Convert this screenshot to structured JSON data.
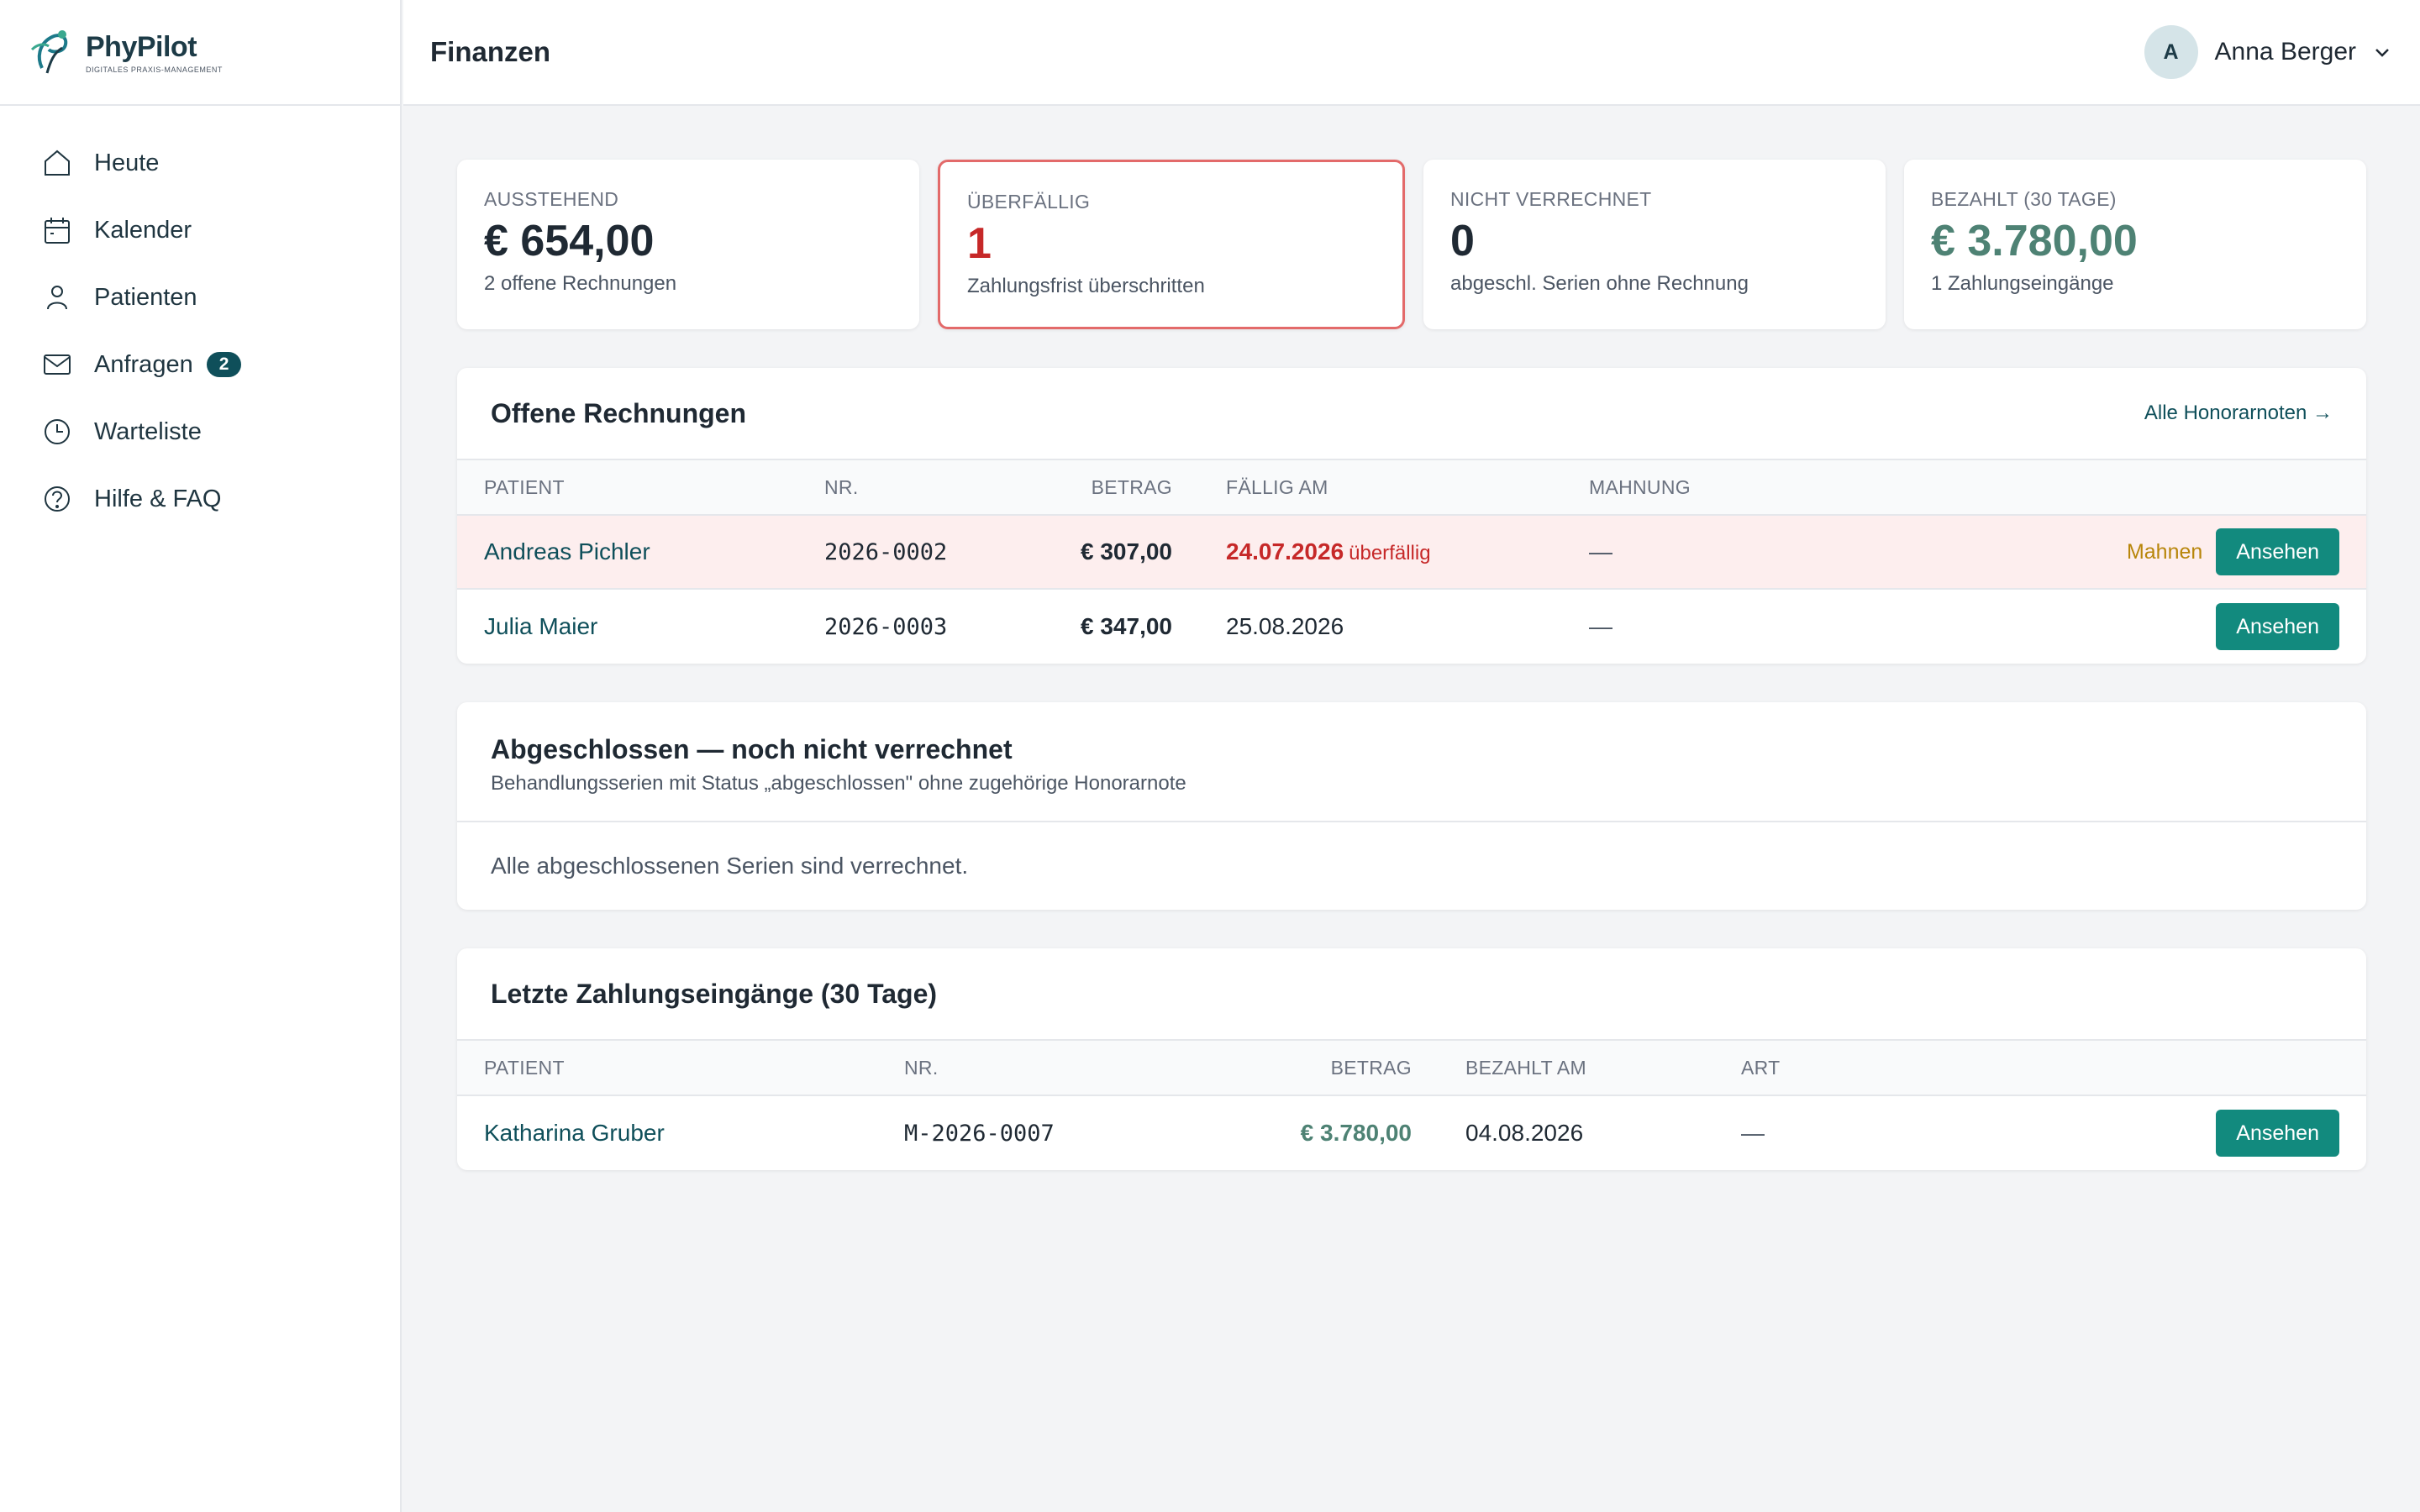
{
  "brand": {
    "name": "PhyPilot",
    "tagline": "DIGITALES PRAXIS-MANAGEMENT"
  },
  "sidebar": {
    "items": [
      {
        "label": "Heute",
        "icon": "home-icon"
      },
      {
        "label": "Kalender",
        "icon": "calendar-icon"
      },
      {
        "label": "Patienten",
        "icon": "person-icon"
      },
      {
        "label": "Anfragen",
        "icon": "mail-icon",
        "badge": "2"
      },
      {
        "label": "Warteliste",
        "icon": "clock-icon"
      },
      {
        "label": "Hilfe & FAQ",
        "icon": "help-icon"
      }
    ]
  },
  "header": {
    "title": "Finanzen",
    "user": {
      "initial": "A",
      "name": "Anna Berger"
    }
  },
  "kpis": [
    {
      "label": "AUSSTEHEND",
      "value": "€ 654,00",
      "sub": "2 offene Rechnungen"
    },
    {
      "label": "ÜBERFÄLLIG",
      "value": "1",
      "sub": "Zahlungsfrist überschritten"
    },
    {
      "label": "NICHT VERRECHNET",
      "value": "0",
      "sub": "abgeschl. Serien ohne Rechnung"
    },
    {
      "label": "BEZAHLT (30 TAGE)",
      "value": "€ 3.780,00",
      "sub": "1 Zahlungseingänge"
    }
  ],
  "open_invoices": {
    "title": "Offene Rechnungen",
    "link": "Alle Honorarnoten →",
    "columns": [
      "PATIENT",
      "NR.",
      "BETRAG",
      "FÄLLIG AM",
      "MAHNUNG"
    ],
    "rows": [
      {
        "patient": "Andreas Pichler",
        "nr": "2026-0002",
        "amount": "€ 307,00",
        "due": "24.07.2026",
        "due_tag": "überfällig",
        "reminder": "—",
        "remind_action": "Mahnen",
        "view_action": "Ansehen"
      },
      {
        "patient": "Julia Maier",
        "nr": "2026-0003",
        "amount": "€ 347,00",
        "due": "25.08.2026",
        "reminder": "—",
        "view_action": "Ansehen"
      }
    ]
  },
  "unbilled": {
    "title": "Abgeschlossen — noch nicht verrechnet",
    "description": "Behandlungsserien mit Status „abgeschlossen\" ohne zugehörige Honorarnote",
    "empty": "Alle abgeschlossenen Serien sind verrechnet."
  },
  "payments": {
    "title": "Letzte Zahlungseingänge (30 Tage)",
    "columns": [
      "PATIENT",
      "NR.",
      "BETRAG",
      "BEZAHLT AM",
      "ART"
    ],
    "rows": [
      {
        "patient": "Katharina Gruber",
        "nr": "M-2026-0007",
        "amount": "€ 3.780,00",
        "paid": "04.08.2026",
        "type": "—",
        "view_action": "Ansehen"
      }
    ]
  },
  "colors": {
    "accent": "#128a7e",
    "brand": "#0f4f5a",
    "danger": "#c62828",
    "success": "#4e8274",
    "warning": "#b8860b"
  }
}
